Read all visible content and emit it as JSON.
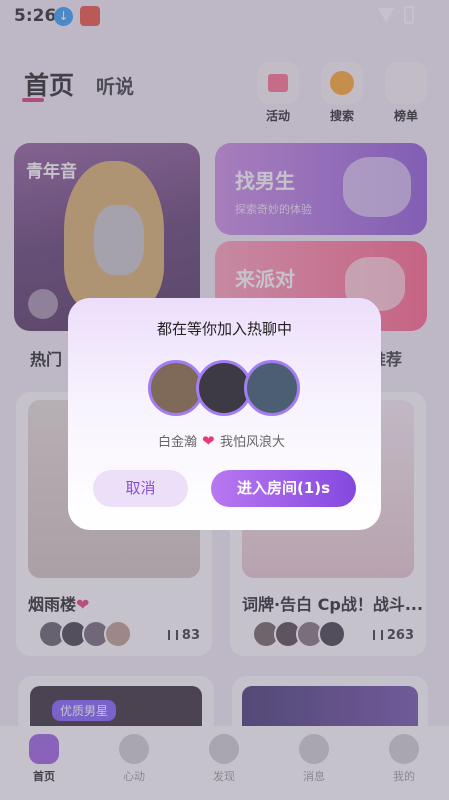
{
  "status_bar": {
    "time": "5:26"
  },
  "header": {
    "tab_home": "首页",
    "tab_listen": "听说",
    "actions": [
      {
        "label": "活动",
        "icon": "gift-icon"
      },
      {
        "label": "搜索",
        "icon": "search-icon"
      },
      {
        "label": "榜单",
        "icon": "rank-avatar-icon"
      }
    ]
  },
  "banners": {
    "youth_voice": {
      "title": "青年音"
    },
    "find_boy": {
      "title": "找男生",
      "subtitle": "探索奇妙的体验"
    },
    "party": {
      "title": "来派对"
    }
  },
  "sections": {
    "hot": "热门",
    "recommend": "推荐"
  },
  "rooms": [
    {
      "name": "烟雨楼",
      "heart": "❤",
      "count": "83"
    },
    {
      "name": "词牌·告白 Cp战！战斗...",
      "heart": "",
      "count": "263"
    },
    {
      "tag": "优质男星"
    },
    {}
  ],
  "tabbar": [
    {
      "label": "首页",
      "icon": "home-icon",
      "active": true
    },
    {
      "label": "心动",
      "icon": "heart-icon",
      "active": false
    },
    {
      "label": "发现",
      "icon": "discover-icon",
      "active": false
    },
    {
      "label": "消息",
      "icon": "message-icon",
      "active": false
    },
    {
      "label": "我的",
      "icon": "profile-icon",
      "active": false
    }
  ],
  "dialog": {
    "title": "都在等你加入热聊中",
    "name_a": "白金瀚",
    "heart": "❤",
    "name_b": "我怕风浪大",
    "cancel_label": "取消",
    "enter_label": "进入房间(1)s"
  },
  "colors": {
    "accent": "#9a5be0",
    "heart": "#e83a74"
  }
}
